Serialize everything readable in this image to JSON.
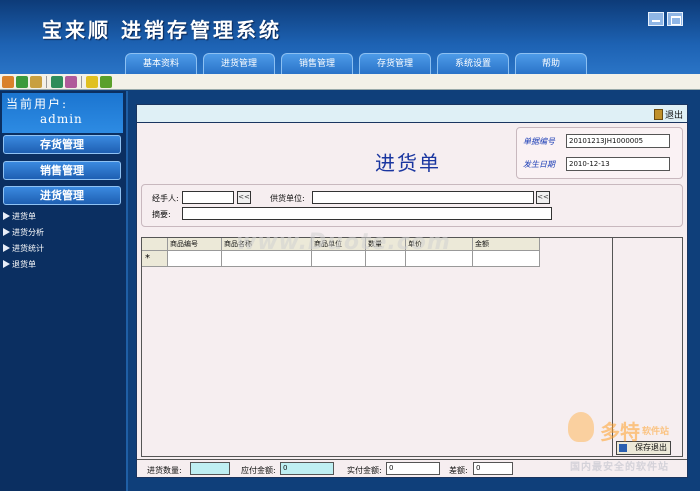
{
  "app": {
    "title": "宝来顺 进销存管理系统"
  },
  "menu": [
    "基本资料",
    "进货管理",
    "销售管理",
    "存货管理",
    "系统设置",
    "帮助"
  ],
  "sidebar": {
    "current_user_label": "当前用户:",
    "current_user": "admin",
    "sections": [
      "存货管理",
      "销售管理",
      "进货管理"
    ],
    "items": [
      "进货单",
      "进货分析",
      "进货统计",
      "退货单"
    ]
  },
  "panel": {
    "exit_label": "退出",
    "title": "进货单",
    "doc_no_label": "单据编号",
    "doc_no": "20101213JH1000005",
    "date_label": "发生日期",
    "date": "2010-12-13",
    "handler_label": "经手人:",
    "supplier_label": "供货单位:",
    "summary_label": "摘要:",
    "browse_symbol": "<<"
  },
  "grid": {
    "columns": [
      "商品编号",
      "商品名称",
      "商品单位",
      "数量",
      "单价",
      "金额"
    ],
    "new_row_marker": "*"
  },
  "actions": {
    "save_exit": "保存退出"
  },
  "footer": {
    "qty_label": "进货数量:",
    "payable_label": "应付金额:",
    "payable": "0",
    "paid_label": "实付金额:",
    "paid": "0",
    "diff_label": "差额:",
    "diff": "0"
  },
  "watermarks": {
    "center": "www.Duote.com",
    "brand": "多特",
    "brand_sub": "软件站",
    "tagline": "国内最安全的软件站"
  },
  "colors": {
    "header": "#1d62b3",
    "panel": "#f6eef0",
    "title": "#1a36a0"
  }
}
